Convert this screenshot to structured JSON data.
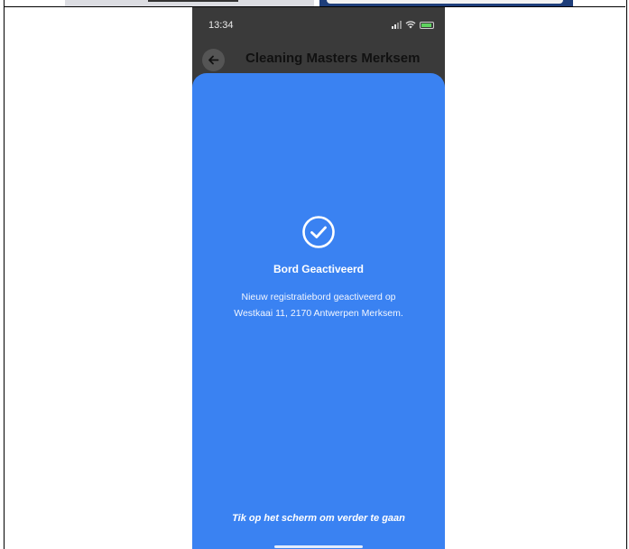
{
  "status_bar": {
    "time": "13:34"
  },
  "header": {
    "title": "Cleaning Masters Merksem"
  },
  "confirmation": {
    "title": "Bord Geactiveerd",
    "line1": "Nieuw registratiebord geactiveerd op",
    "line2": "Westkaai 11, 2170 Antwerpen Merksem.",
    "hint": "Tik op het scherm om verder te gaan"
  },
  "icons": {
    "back": "arrow-left-icon",
    "success": "check-circle-icon"
  },
  "colors": {
    "sheet": "#3a82f2",
    "overlay": "#3a3a3a"
  }
}
